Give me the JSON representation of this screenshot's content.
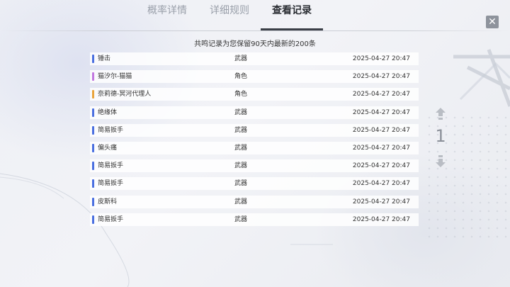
{
  "tabs": [
    {
      "label": "概率详情",
      "active": false
    },
    {
      "label": "详细规则",
      "active": false
    },
    {
      "label": "查看记录",
      "active": true
    }
  ],
  "close_label": "✕",
  "notice": "共鸣记录为您保留90天内最新的200条",
  "colors": {
    "weapon": "#4a6fe0",
    "char_purple": "#c277e0",
    "char_gold": "#e9a43c"
  },
  "records": [
    {
      "name": "锤击",
      "type": "武器",
      "time": "2025-04-27  20:47",
      "color": "#4a6fe0"
    },
    {
      "name": "猫汐尔-猫猫",
      "type": "角色",
      "time": "2025-04-27  20:47",
      "color": "#c277e0"
    },
    {
      "name": "奈莉德-冥河代理人",
      "type": "角色",
      "time": "2025-04-27  20:47",
      "color": "#e9a43c"
    },
    {
      "name": "绝缘体",
      "type": "武器",
      "time": "2025-04-27  20:47",
      "color": "#4a6fe0"
    },
    {
      "name": "简易扳手",
      "type": "武器",
      "time": "2025-04-27  20:47",
      "color": "#4a6fe0"
    },
    {
      "name": "偏头痛",
      "type": "武器",
      "time": "2025-04-27  20:47",
      "color": "#4a6fe0"
    },
    {
      "name": "简易扳手",
      "type": "武器",
      "time": "2025-04-27  20:47",
      "color": "#4a6fe0"
    },
    {
      "name": "简易扳手",
      "type": "武器",
      "time": "2025-04-27  20:47",
      "color": "#4a6fe0"
    },
    {
      "name": "皮斯科",
      "type": "武器",
      "time": "2025-04-27  20:47",
      "color": "#4a6fe0"
    },
    {
      "name": "简易扳手",
      "type": "武器",
      "time": "2025-04-27  20:47",
      "color": "#4a6fe0"
    }
  ],
  "pager": {
    "page": "1",
    "up_icon": "arrow-up-icon",
    "down_icon": "arrow-down-icon"
  }
}
